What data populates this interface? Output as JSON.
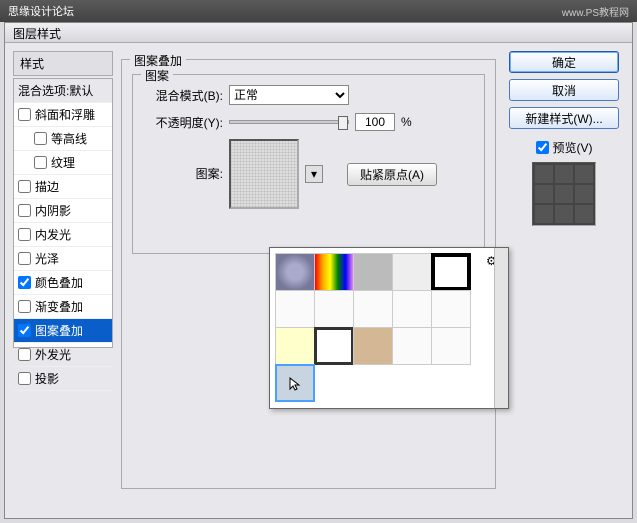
{
  "titlebar": {
    "site": "思缘设计论坛",
    "url": "www.PS教程网"
  },
  "dialog": {
    "title": "图层样式"
  },
  "left": {
    "header": "样式",
    "default_label": "混合选项:默认",
    "items": [
      {
        "label": "斜面和浮雕",
        "checked": false
      },
      {
        "label": "等高线",
        "checked": false,
        "indent": true
      },
      {
        "label": "纹理",
        "checked": false,
        "indent": true
      },
      {
        "label": "描边",
        "checked": false
      },
      {
        "label": "内阴影",
        "checked": false
      },
      {
        "label": "内发光",
        "checked": false
      },
      {
        "label": "光泽",
        "checked": false
      },
      {
        "label": "颜色叠加",
        "checked": true
      },
      {
        "label": "渐变叠加",
        "checked": false
      },
      {
        "label": "图案叠加",
        "checked": true,
        "selected": true
      },
      {
        "label": "外发光",
        "checked": false
      },
      {
        "label": "投影",
        "checked": false
      }
    ]
  },
  "middle": {
    "group_title": "图案叠加",
    "inner_title": "图案",
    "blend_label": "混合模式(B):",
    "blend_value": "正常",
    "opacity_label": "不透明度(Y):",
    "opacity_value": "100",
    "opacity_unit": "%",
    "pattern_label": "图案:",
    "snap_label": "贴紧原点(A)",
    "scale_unit": "%"
  },
  "right": {
    "ok": "确定",
    "cancel": "取消",
    "new_style": "新建样式(W)...",
    "preview": "预览(V)"
  },
  "icons": {
    "dropdown": "▾",
    "gear": "⚙",
    "percent": "%"
  }
}
